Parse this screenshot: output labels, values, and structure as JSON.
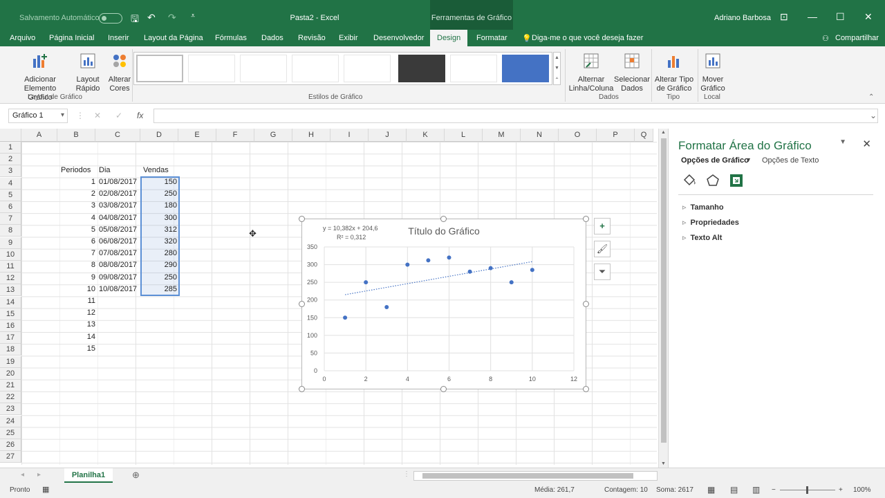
{
  "titlebar": {
    "autosave_label": "Salvamento Automático",
    "title": "Pasta2  -  Excel",
    "contextual_tools": "Ferramentas de Gráfico",
    "user": "Adriano Barbosa"
  },
  "tabs": [
    "Arquivo",
    "Página Inicial",
    "Inserir",
    "Layout da Página",
    "Fórmulas",
    "Dados",
    "Revisão",
    "Exibir",
    "Desenvolvedor",
    "Design",
    "Formatar"
  ],
  "tell_me": "Diga-me o que você deseja fazer",
  "share": "Compartilhar",
  "ribbon": {
    "add_element": [
      "Adicionar Elemento",
      "Gráfico"
    ],
    "quick_layout": [
      "Layout",
      "Rápido"
    ],
    "change_colors": [
      "Alterar",
      "Cores"
    ],
    "group_layout": "Layout de Gráfico",
    "group_styles": "Estilos de Gráfico",
    "switch_row_col": [
      "Alternar",
      "Linha/Coluna"
    ],
    "select_data": [
      "Selecionar",
      "Dados"
    ],
    "group_data": "Dados",
    "change_type": [
      "Alterar Tipo",
      "de Gráfico"
    ],
    "group_type": "Tipo",
    "move_chart": [
      "Mover",
      "Gráfico"
    ],
    "group_location": "Local"
  },
  "formula_bar": {
    "name_box": "Gráfico 1",
    "fx": "fx",
    "formula": ""
  },
  "columns": [
    "A",
    "B",
    "C",
    "D",
    "E",
    "F",
    "G",
    "H",
    "I",
    "J",
    "K",
    "L",
    "M",
    "N",
    "O",
    "P",
    "Q"
  ],
  "rows": [
    "1",
    "2",
    "3",
    "4",
    "5",
    "6",
    "7",
    "8",
    "9",
    "10",
    "11",
    "12",
    "13",
    "14",
    "15",
    "16",
    "17",
    "18",
    "19",
    "20",
    "21",
    "22",
    "23",
    "24",
    "25",
    "26",
    "27"
  ],
  "headers": {
    "periodos": "Periodos",
    "dia": "Dia",
    "vendas": "Vendas"
  },
  "table": [
    {
      "p": "1",
      "d": "01/08/2017",
      "v": "150"
    },
    {
      "p": "2",
      "d": "02/08/2017",
      "v": "250"
    },
    {
      "p": "3",
      "d": "03/08/2017",
      "v": "180"
    },
    {
      "p": "4",
      "d": "04/08/2017",
      "v": "300"
    },
    {
      "p": "5",
      "d": "05/08/2017",
      "v": "312"
    },
    {
      "p": "6",
      "d": "06/08/2017",
      "v": "320"
    },
    {
      "p": "7",
      "d": "07/08/2017",
      "v": "280"
    },
    {
      "p": "8",
      "d": "08/08/2017",
      "v": "290"
    },
    {
      "p": "9",
      "d": "09/08/2017",
      "v": "250"
    },
    {
      "p": "10",
      "d": "10/08/2017",
      "v": "285"
    },
    {
      "p": "11",
      "d": "",
      "v": ""
    },
    {
      "p": "12",
      "d": "",
      "v": ""
    },
    {
      "p": "13",
      "d": "",
      "v": ""
    },
    {
      "p": "14",
      "d": "",
      "v": ""
    },
    {
      "p": "15",
      "d": "",
      "v": ""
    }
  ],
  "chart_data": {
    "type": "scatter",
    "title": "Título do Gráfico",
    "equation": "y = 10,382x + 204,6",
    "r2": "R² = 0,312",
    "x": [
      1,
      2,
      3,
      4,
      5,
      6,
      7,
      8,
      9,
      10
    ],
    "y": [
      150,
      250,
      180,
      300,
      312,
      320,
      280,
      290,
      250,
      285
    ],
    "trendline": {
      "slope": 10.382,
      "intercept": 204.6,
      "x_range": [
        1,
        10
      ]
    },
    "xlim": [
      0,
      12
    ],
    "ylim": [
      0,
      350
    ],
    "xticks": [
      "0",
      "2",
      "4",
      "6",
      "8",
      "10",
      "12"
    ],
    "yticks": [
      "0",
      "50",
      "100",
      "150",
      "200",
      "250",
      "300",
      "350"
    ],
    "grid": true,
    "point_color": "#4472c4"
  },
  "panel": {
    "title": "Formatar Área do Gráfico",
    "tab_chart": "Opções de Gráfico",
    "tab_text": "Opções de Texto",
    "sections": [
      "Tamanho",
      "Propriedades",
      "Texto Alt"
    ]
  },
  "sheet_tab": "Planilha1",
  "status": {
    "ready": "Pronto",
    "average": "Média: 261,7",
    "count": "Contagem: 10",
    "sum": "Soma: 2617",
    "zoom": "100%"
  },
  "colors": {
    "accent": "#217346",
    "selection": "#5b8fd5"
  }
}
